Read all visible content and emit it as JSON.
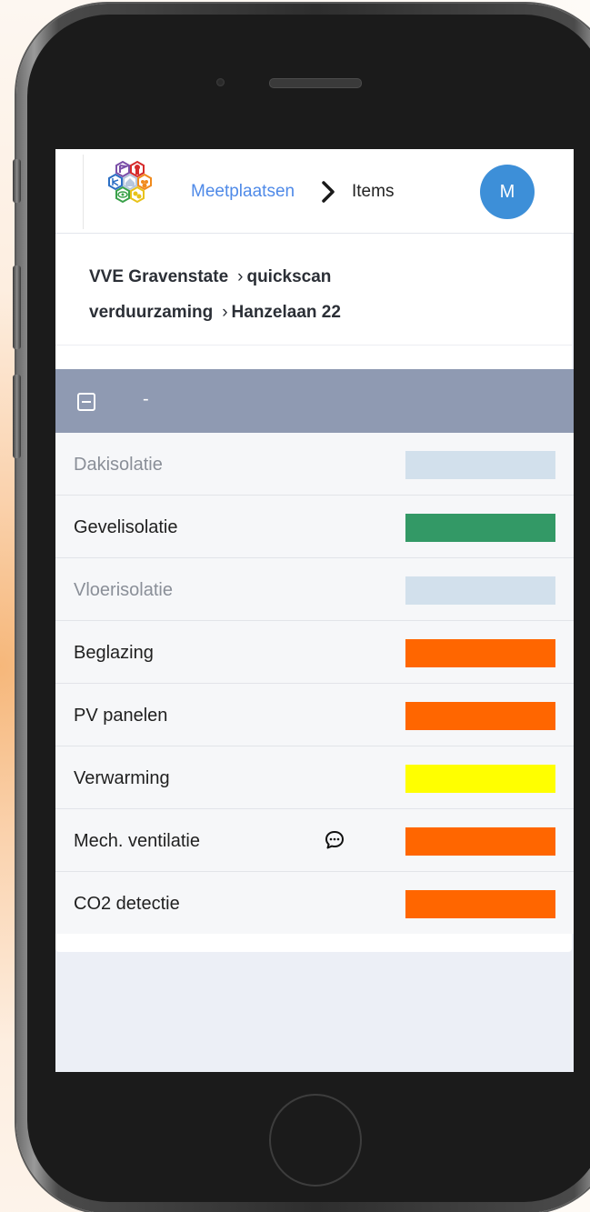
{
  "nav": {
    "breadcrumb_link": "Meetplaatsen",
    "breadcrumb_current": "Items",
    "avatar_initial": "M"
  },
  "path": {
    "parts": [
      "VVE Gravenstate",
      "quickscan verduurzaming",
      "Hanzelaan 22"
    ]
  },
  "group": {
    "label": "-",
    "collapse_icon": "minus-square-icon"
  },
  "items": [
    {
      "label": "Dakisolatie",
      "muted": true,
      "status_color": "#d2e0ec",
      "comment": false
    },
    {
      "label": "Gevelisolatie",
      "muted": false,
      "status_color": "#339966",
      "comment": false
    },
    {
      "label": "Vloerisolatie",
      "muted": true,
      "status_color": "#d2e0ec",
      "comment": false
    },
    {
      "label": "Beglazing",
      "muted": false,
      "status_color": "#ff6600",
      "comment": false
    },
    {
      "label": "PV panelen",
      "muted": false,
      "status_color": "#ff6600",
      "comment": false
    },
    {
      "label": "Verwarming",
      "muted": false,
      "status_color": "#ffff00",
      "comment": false
    },
    {
      "label": "Mech. ventilatie",
      "muted": false,
      "status_color": "#ff6600",
      "comment": true
    },
    {
      "label": "CO2 detectie",
      "muted": false,
      "status_color": "#ff6600",
      "comment": false
    }
  ],
  "colors": {
    "accent": "#4f8ae8",
    "avatar": "#3d8fd8",
    "group_header": "#8f9ab2"
  }
}
